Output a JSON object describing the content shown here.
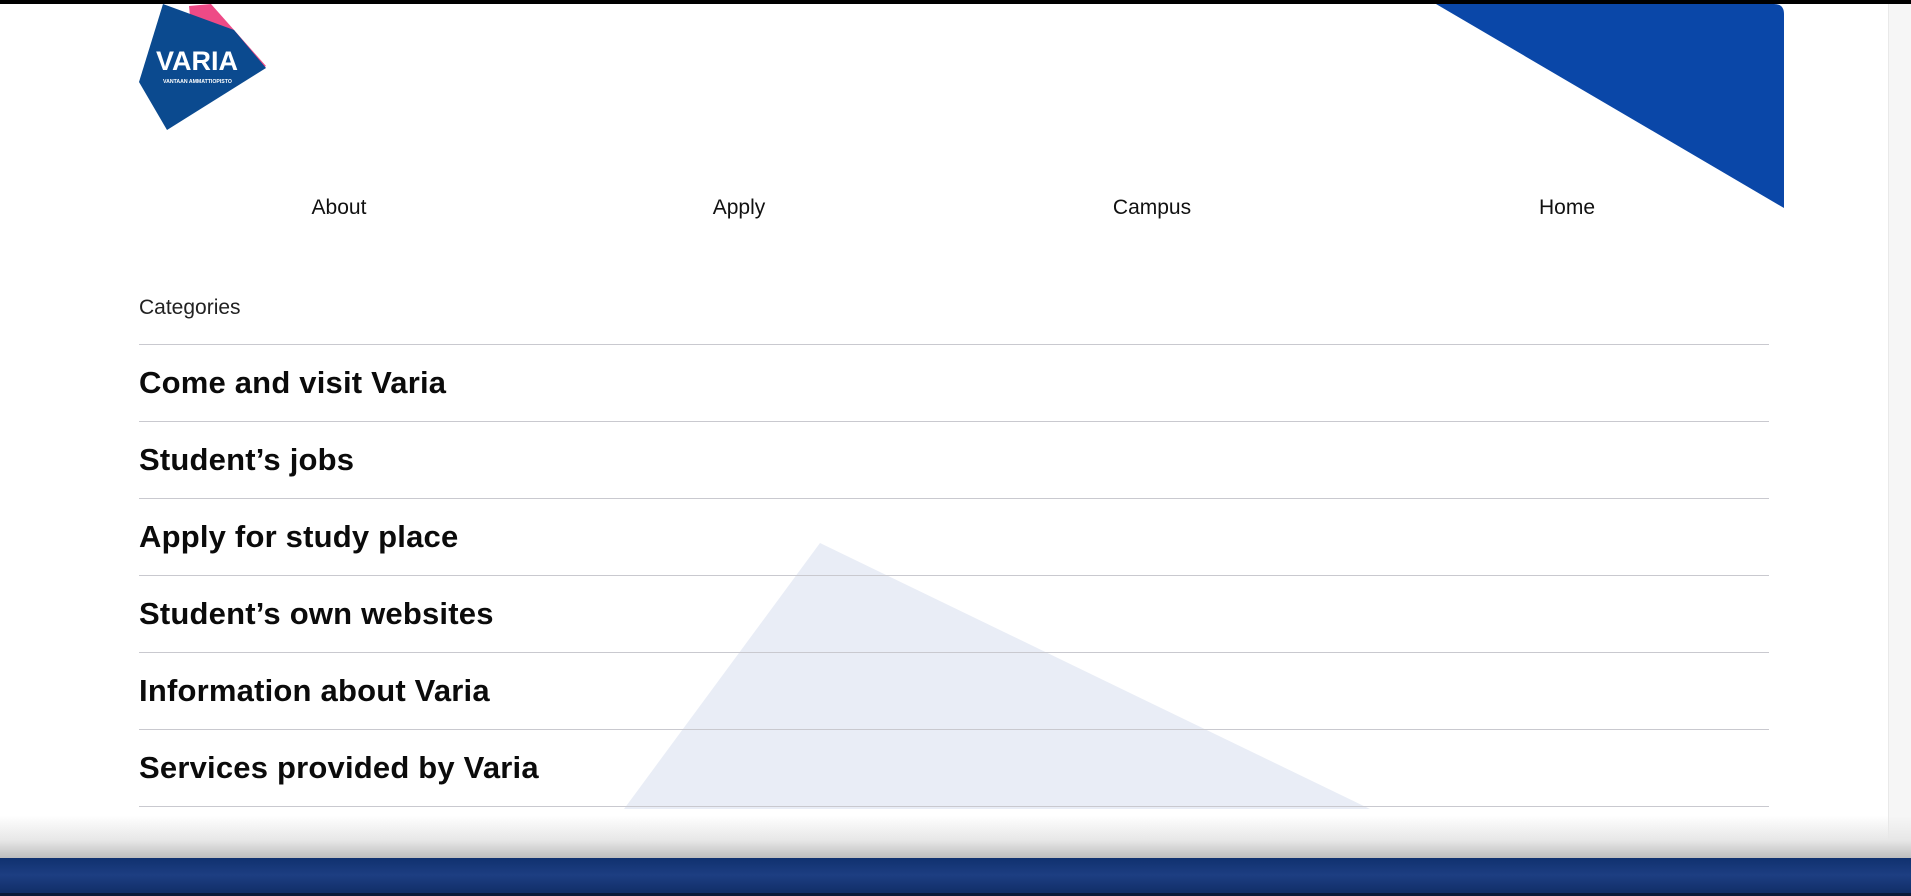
{
  "brand": {
    "logo_text": "VARIA",
    "logo_subtext": "VANTAAN AMMATTIOPISTO",
    "colors": {
      "blue": "#0b4a8f",
      "pink": "#ee4a86",
      "accent_blue": "#0a47a8",
      "light_triangle": "#e9edf6"
    }
  },
  "nav": {
    "items": [
      {
        "label": "About"
      },
      {
        "label": "Apply"
      },
      {
        "label": "Campus"
      },
      {
        "label": "Home"
      }
    ]
  },
  "categories": {
    "heading": "Categories",
    "items": [
      {
        "label": "Come and visit Varia"
      },
      {
        "label": "Student’s jobs"
      },
      {
        "label": "Apply for study place"
      },
      {
        "label": "Student’s own websites"
      },
      {
        "label": "Information about Varia"
      },
      {
        "label": "Services provided by Varia"
      }
    ]
  }
}
